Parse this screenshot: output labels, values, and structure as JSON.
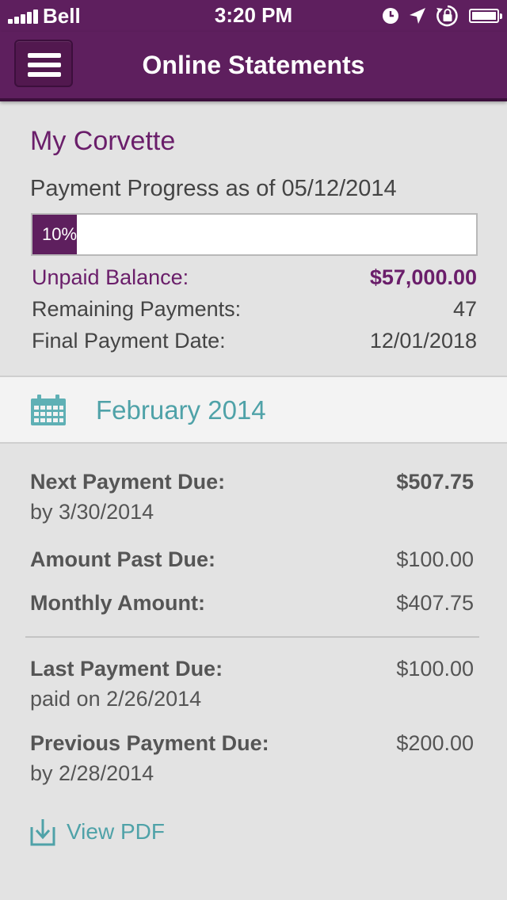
{
  "status_bar": {
    "carrier": "Bell",
    "time": "3:20 PM",
    "icons": [
      "signal-icon",
      "clock-icon",
      "location-arrow-icon",
      "rotation-lock-icon",
      "battery-icon"
    ]
  },
  "nav": {
    "title": "Online Statements",
    "menu_icon": "hamburger-menu-icon"
  },
  "summary": {
    "account_name": "My Corvette",
    "progress_label": "Payment Progress as of 05/12/2014",
    "progress_percent": 10,
    "progress_text": "10%",
    "unpaid_balance_label": "Unpaid Balance:",
    "unpaid_balance_value": "$57,000.00",
    "remaining_payments_label": "Remaining Payments:",
    "remaining_payments_value": "47",
    "final_payment_label": "Final Payment Date:",
    "final_payment_value": "12/01/2018"
  },
  "month": {
    "icon": "calendar-icon",
    "title": "February 2014"
  },
  "details": {
    "next_payment": {
      "label": "Next Payment Due:",
      "value": "$507.75",
      "sub": "by 3/30/2014"
    },
    "amount_past_due": {
      "label": "Amount Past Due:",
      "value": "$100.00"
    },
    "monthly_amount": {
      "label": "Monthly Amount:",
      "value": "$407.75"
    },
    "last_payment": {
      "label": "Last Payment Due:",
      "value": "$100.00",
      "sub": "paid on 2/26/2014"
    },
    "previous_payment": {
      "label": "Previous Payment Due:",
      "value": "$200.00",
      "sub": "by 2/28/2014"
    },
    "view_pdf_label": "View PDF",
    "view_pdf_icon": "download-icon"
  },
  "colors": {
    "brand_purple": "#5e1f5e",
    "accent_teal": "#4fa2a8",
    "text_gray": "#555555"
  }
}
